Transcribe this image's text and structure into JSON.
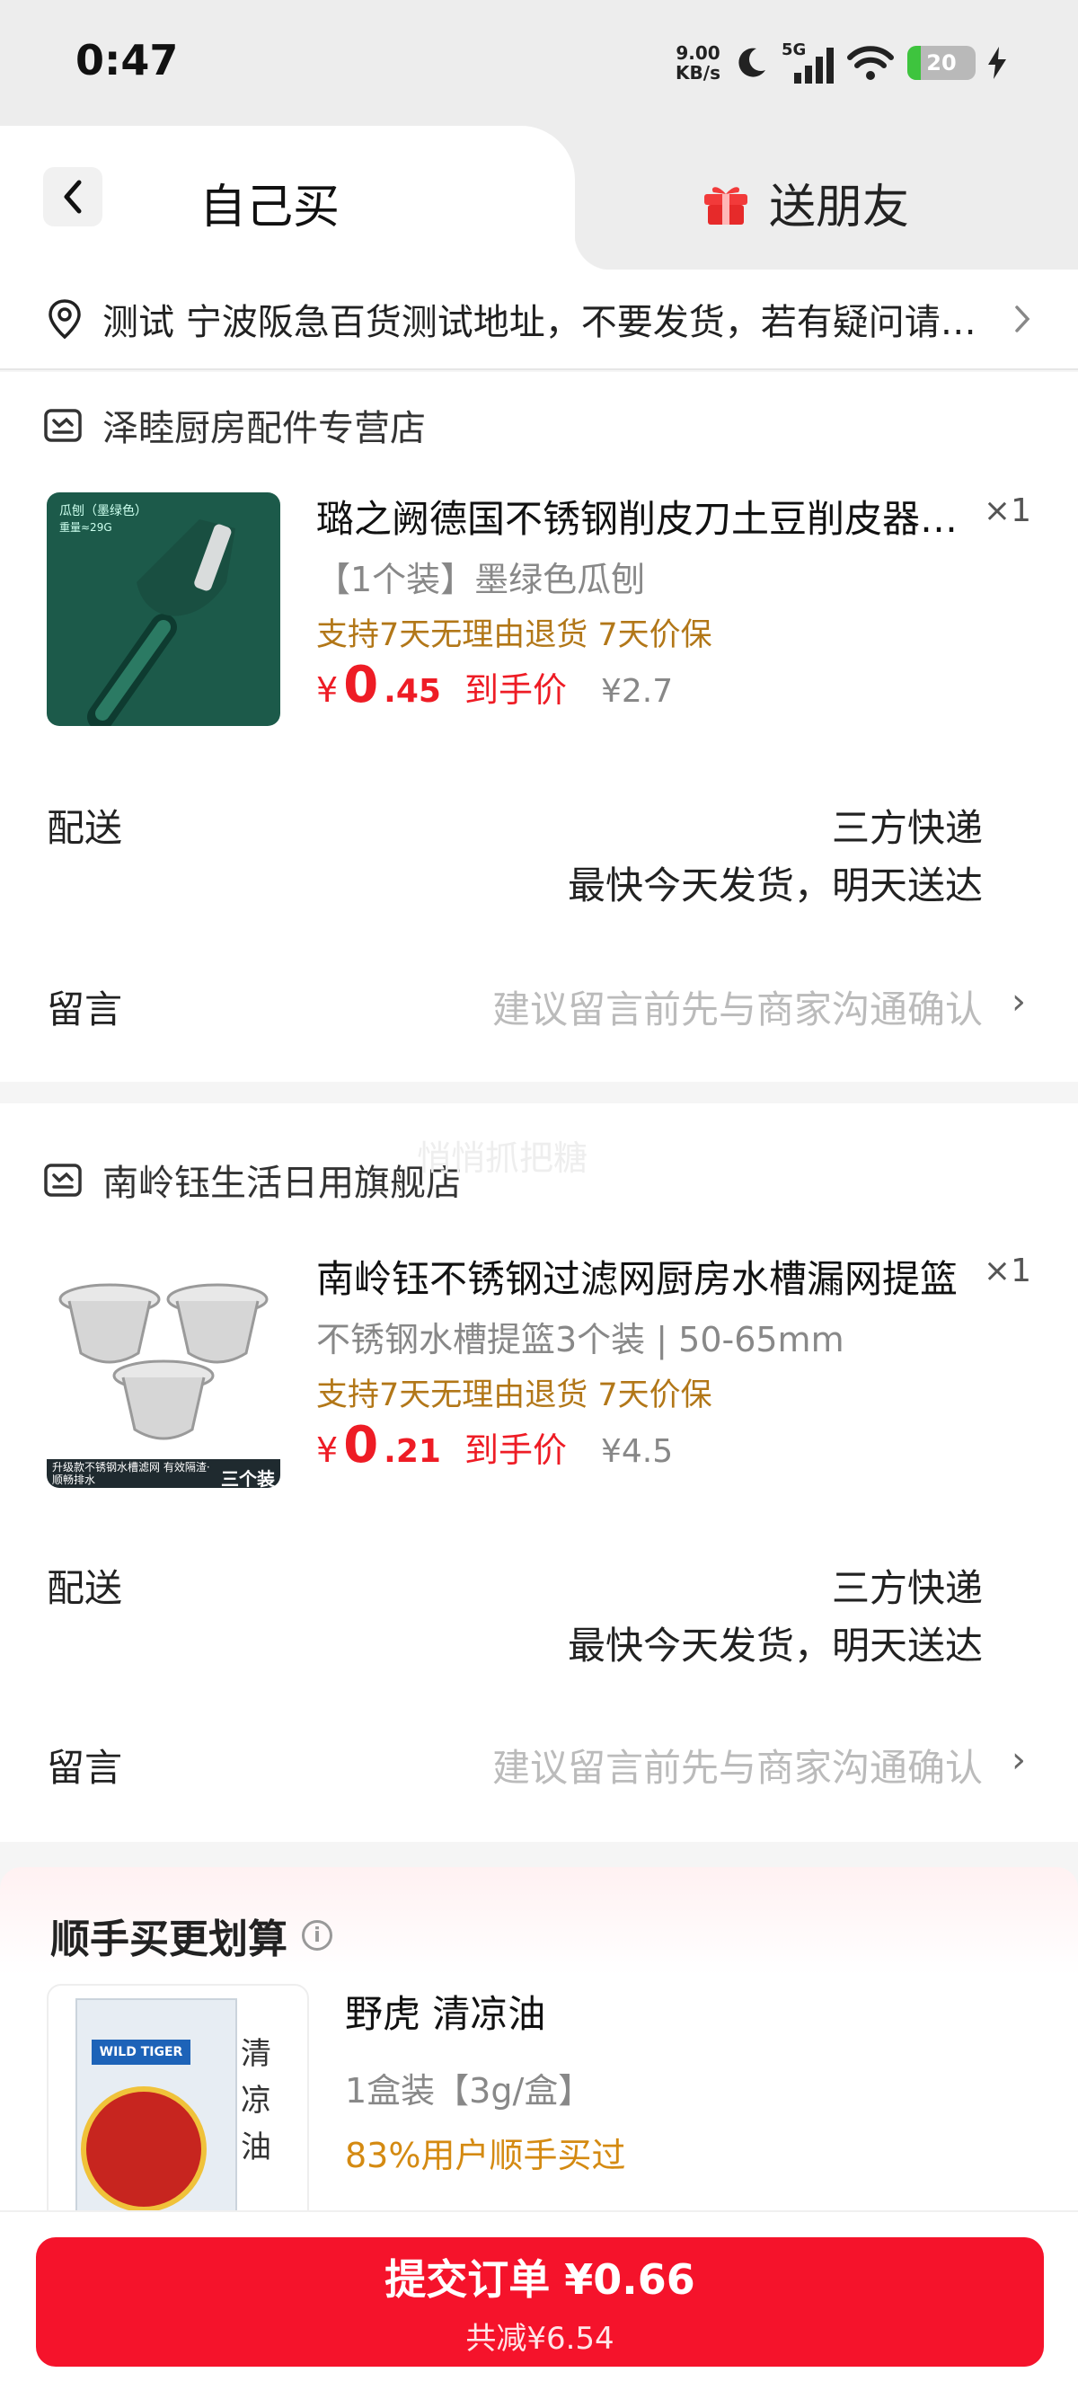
{
  "status_bar": {
    "time": "0:47",
    "net_speed_value": "9.00",
    "net_speed_unit": "KB/s",
    "network": "5G",
    "battery": "20"
  },
  "header": {
    "tab_self": "自己买",
    "tab_gift": "送朋友"
  },
  "address": {
    "text": "测试  宁波阪急百货测试地址，不要发货，若有疑问请联系商家"
  },
  "orders": [
    {
      "store": "泽睦厨房配件专营店",
      "product_title": "璐之阙德国不锈钢削皮刀土豆削皮器瓜刨",
      "quantity": "×1",
      "spec": "【1个装】墨绿色瓜刨",
      "service": "支持7天无理由退货  7天价保",
      "price_symbol": "¥",
      "price_int": "0",
      "price_dec": ".45",
      "price_tag": "到手价",
      "original_price": "¥2.7",
      "thumb_label": "瓜刨（墨绿色）",
      "thumb_sub": "重量≈29G",
      "delivery_label": "配送",
      "delivery_method": "三方快递",
      "delivery_eta": "最快今天发货，明天送达",
      "note_label": "留言",
      "note_hint": "建议留言前先与商家沟通确认"
    },
    {
      "store": "南岭钰生活日用旗舰店",
      "product_title": "南岭钰不锈钢过滤网厨房水槽漏网提篮",
      "quantity": "×1",
      "spec": "不锈钢水槽提篮3个装 | 50-65mm",
      "service": "支持7天无理由退货  7天价保",
      "price_symbol": "¥",
      "price_int": "0",
      "price_dec": ".21",
      "price_tag": "到手价",
      "original_price": "¥4.5",
      "thumb_banner": "升级款不锈钢水槽滤网 有效隔渣·顺畅排水",
      "thumb_badge": "三个装",
      "delivery_label": "配送",
      "delivery_method": "三方快递",
      "delivery_eta": "最快今天发货，明天送达",
      "note_label": "留言",
      "note_hint": "建议留言前先与商家沟通确认"
    }
  ],
  "watermark": "悄悄抓把糖",
  "addon": {
    "title": "顺手买更划算",
    "product_name": "野虎 清凉油",
    "spec": "1盒装【3g/盒】",
    "percent_text": "83%用户顺手买过",
    "thumb_brand": "WILD TIGER",
    "thumb_name": "清凉油"
  },
  "bottom": {
    "submit_label": "提交订单 ¥0.66",
    "saving_label": "共减¥6.54"
  },
  "colors": {
    "accent_red": "#f5132b",
    "price_red": "#ee1c25",
    "service_brown": "#b27718"
  }
}
